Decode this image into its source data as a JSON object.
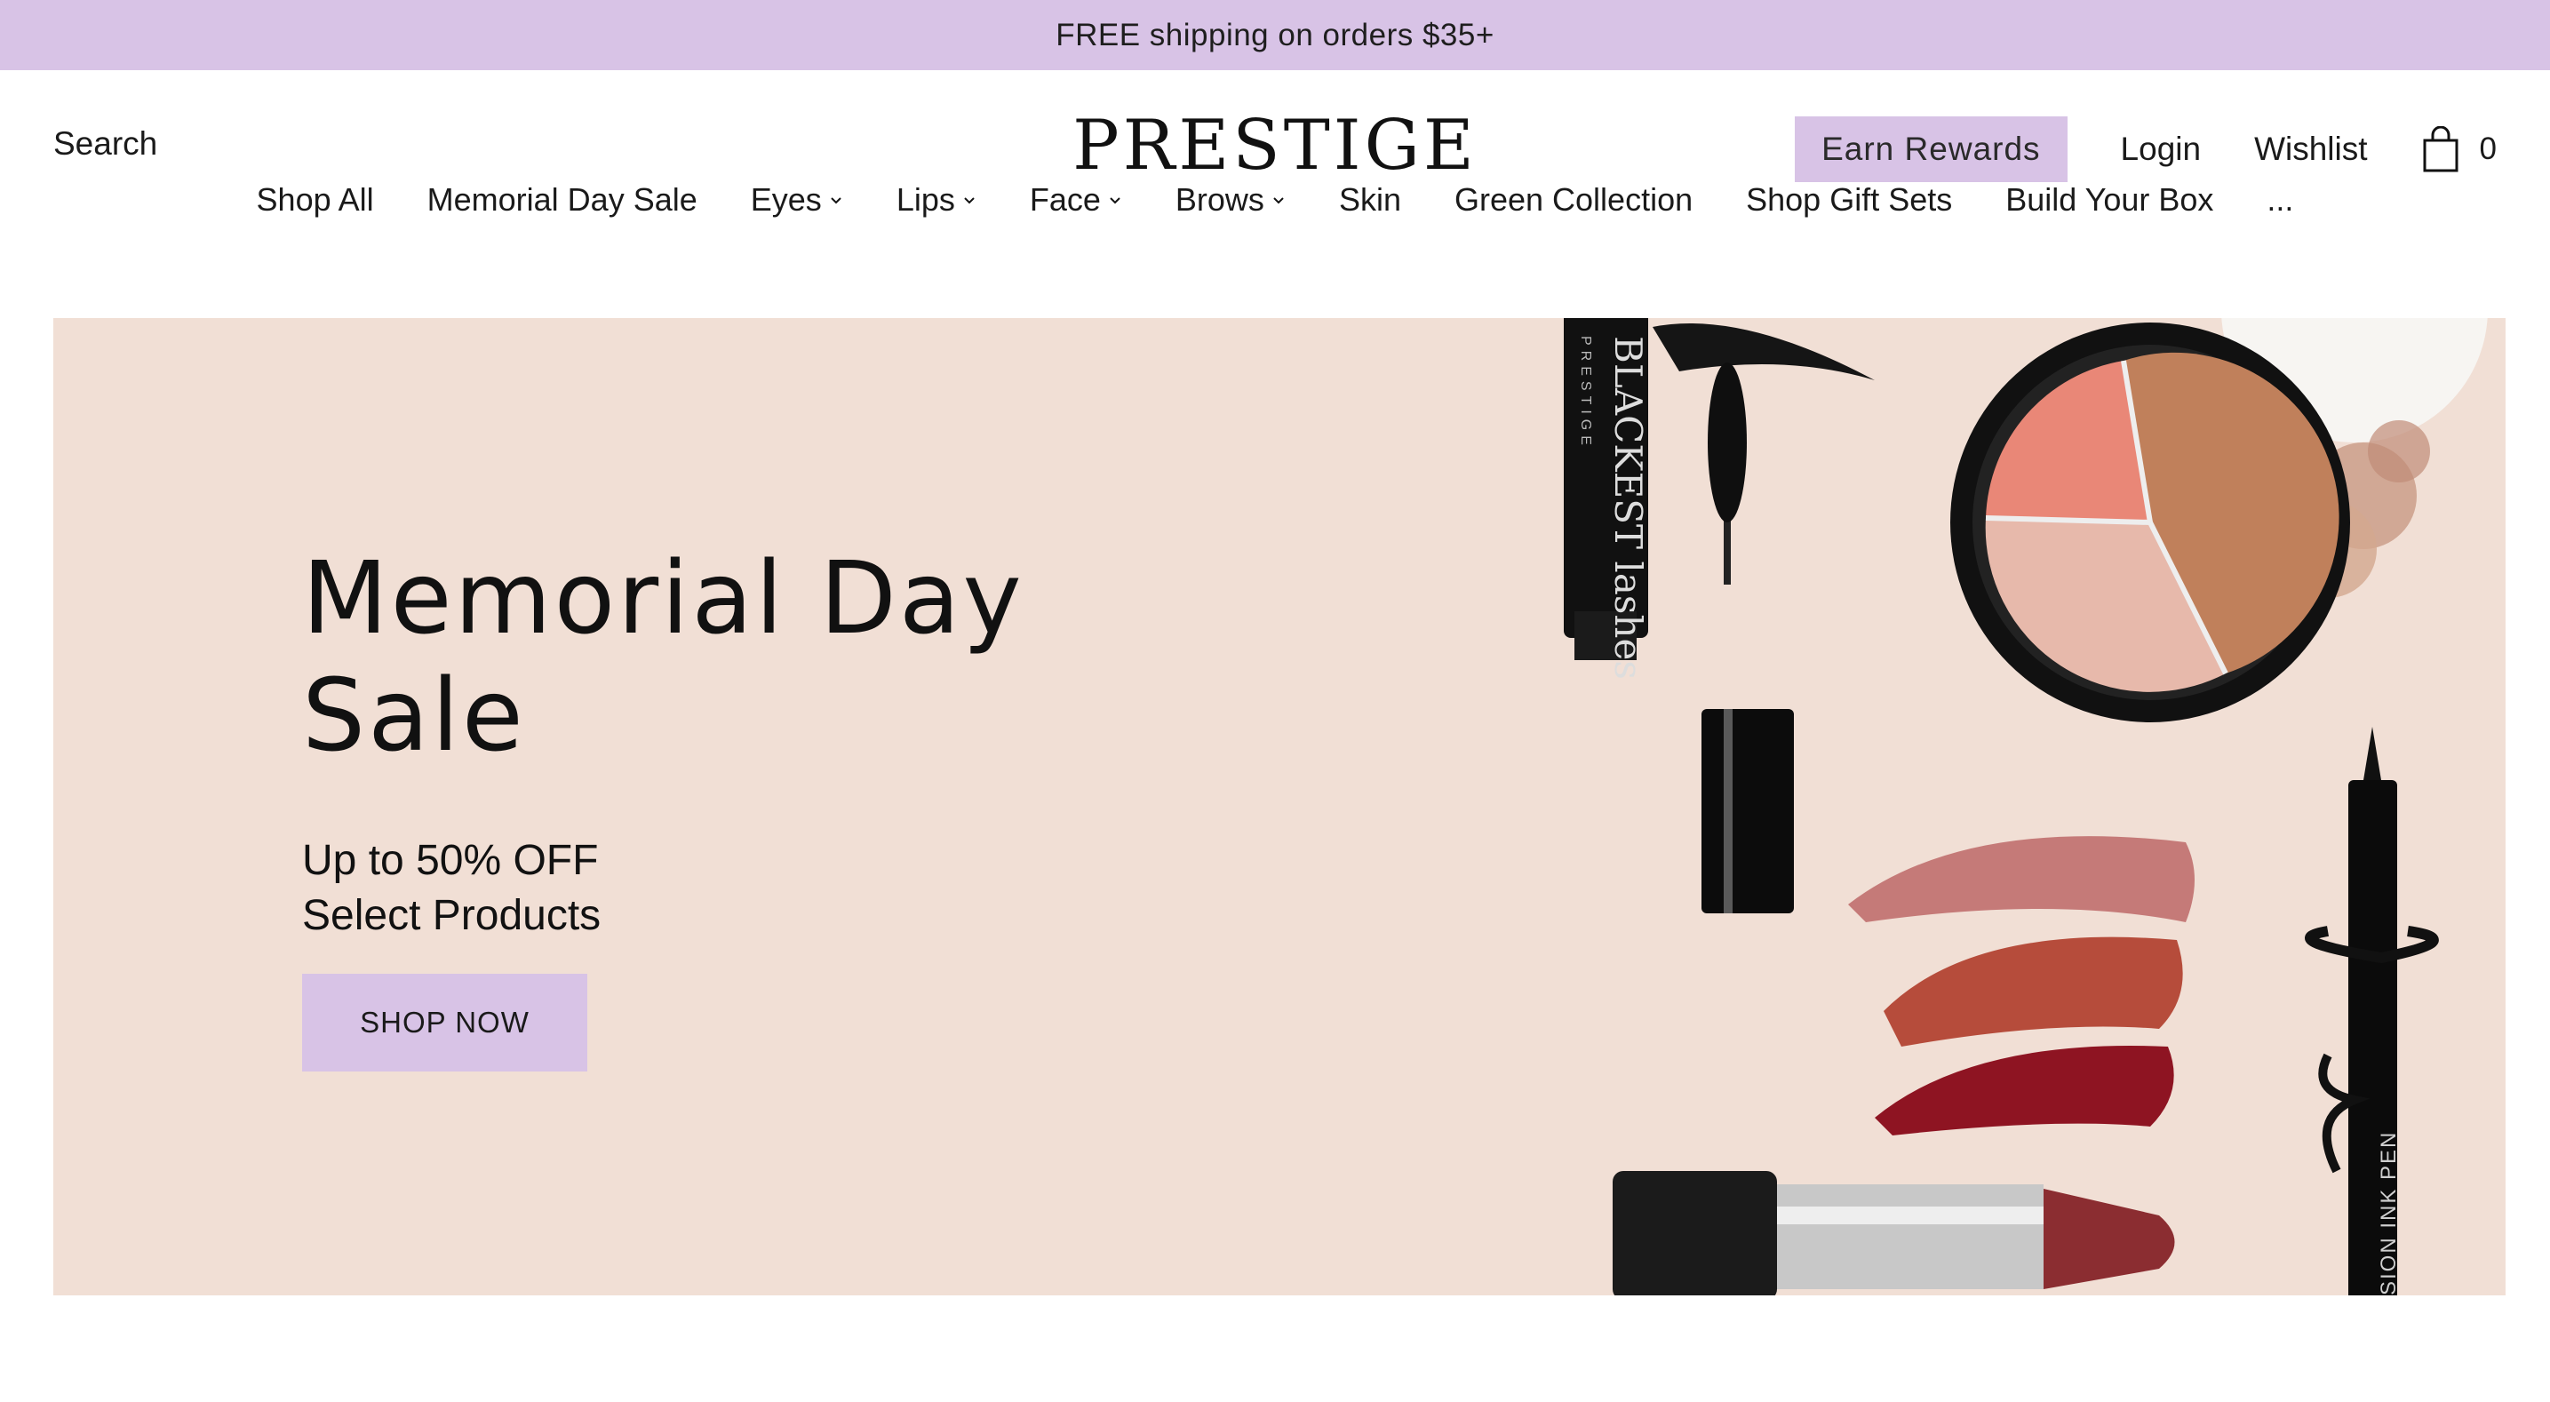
{
  "promo": {
    "text": "FREE shipping on orders $35+"
  },
  "header": {
    "search_label": "Search",
    "logo_text": "PRESTIGE",
    "rewards_label": "Earn Rewards",
    "login_label": "Login",
    "wishlist_label": "Wishlist",
    "cart_count": "0"
  },
  "nav": {
    "items": [
      {
        "label": "Shop All"
      },
      {
        "label": "Memorial Day Sale"
      },
      {
        "label": "Eyes"
      },
      {
        "label": "Lips"
      },
      {
        "label": "Face"
      },
      {
        "label": "Brows"
      },
      {
        "label": "Skin"
      },
      {
        "label": "Green Collection"
      },
      {
        "label": "Shop Gift Sets"
      },
      {
        "label": "Build Your Box"
      },
      {
        "label": "..."
      }
    ]
  },
  "hero": {
    "title_line1": "Memorial Day",
    "title_line2": "Sale",
    "sub_line1": "Up to 50% OFF",
    "sub_line2": "Select Products",
    "cta_label": "SHOP NOW",
    "mascara_brand": "PRESTIGE",
    "mascara_name": "BLACKEST lashes",
    "eyeliner_label": "SION INK PEN"
  },
  "colors": {
    "accent": "#d8c3e6",
    "hero_bg": "#f1dfd5"
  }
}
